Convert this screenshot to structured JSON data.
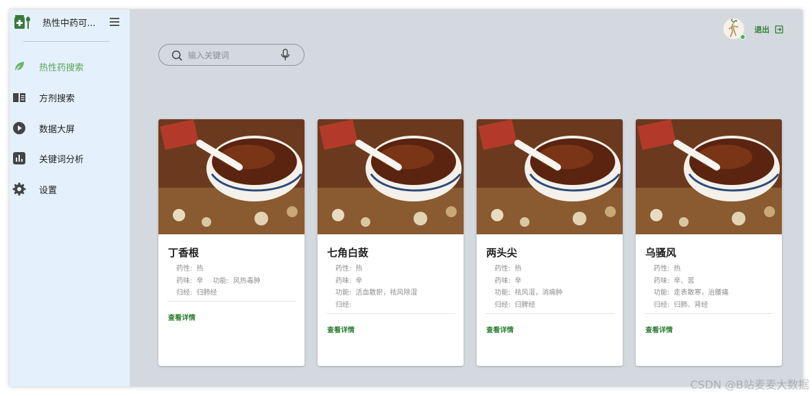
{
  "app": {
    "title": "热性中药可..."
  },
  "sidebar": {
    "items": [
      {
        "label": "热性药搜索",
        "icon": "leaf-icon",
        "active": true
      },
      {
        "label": "方剂搜索",
        "icon": "book-icon",
        "active": false
      },
      {
        "label": "数据大屏",
        "icon": "play-circle-icon",
        "active": false
      },
      {
        "label": "关键词分析",
        "icon": "bar-chart-icon",
        "active": false
      },
      {
        "label": "设置",
        "icon": "gear-icon",
        "active": false
      }
    ]
  },
  "header": {
    "logout_label": "退出"
  },
  "search": {
    "placeholder": "输入关键词",
    "value": ""
  },
  "cards": [
    {
      "name": "丁香根",
      "xing": {
        "key": "药性:",
        "val": "热"
      },
      "wei": {
        "key": "药味:",
        "val": "辛"
      },
      "gongneng": {
        "key": "功能:",
        "val": "风热毒肿"
      },
      "guijing": {
        "key": "归经:",
        "val": "归肺经"
      },
      "link": "查看详情"
    },
    {
      "name": "七角白蔹",
      "xing": {
        "key": "药性:",
        "val": "热"
      },
      "wei": {
        "key": "药味:",
        "val": "辛"
      },
      "gongneng": {
        "key": "功能:",
        "val": "活血散瘀，祛风除湿"
      },
      "guijing": {
        "key": "归经:",
        "val": ""
      },
      "link": "查看详情"
    },
    {
      "name": "两头尖",
      "xing": {
        "key": "药性:",
        "val": "热"
      },
      "wei": {
        "key": "药味:",
        "val": "辛"
      },
      "gongneng": {
        "key": "功能:",
        "val": "祛风湿，消痈肿"
      },
      "guijing": {
        "key": "归经:",
        "val": "归脾经"
      },
      "link": "查看详情"
    },
    {
      "name": "乌骚风",
      "xing": {
        "key": "药性:",
        "val": "热"
      },
      "wei": {
        "key": "药味:",
        "val": "辛、苦"
      },
      "gongneng": {
        "key": "功能:",
        "val": "走表散寒，治腰痛"
      },
      "guijing": {
        "key": "归经:",
        "val": "归肺、肾经"
      },
      "link": "查看详情"
    }
  ],
  "watermark": "CSDN @B站麦麦大数据",
  "colors": {
    "accent": "#2e7d32",
    "active_nav": "#5aa55a",
    "sidebar_bg": "#e4f1fc",
    "main_bg": "#d3d9de"
  }
}
